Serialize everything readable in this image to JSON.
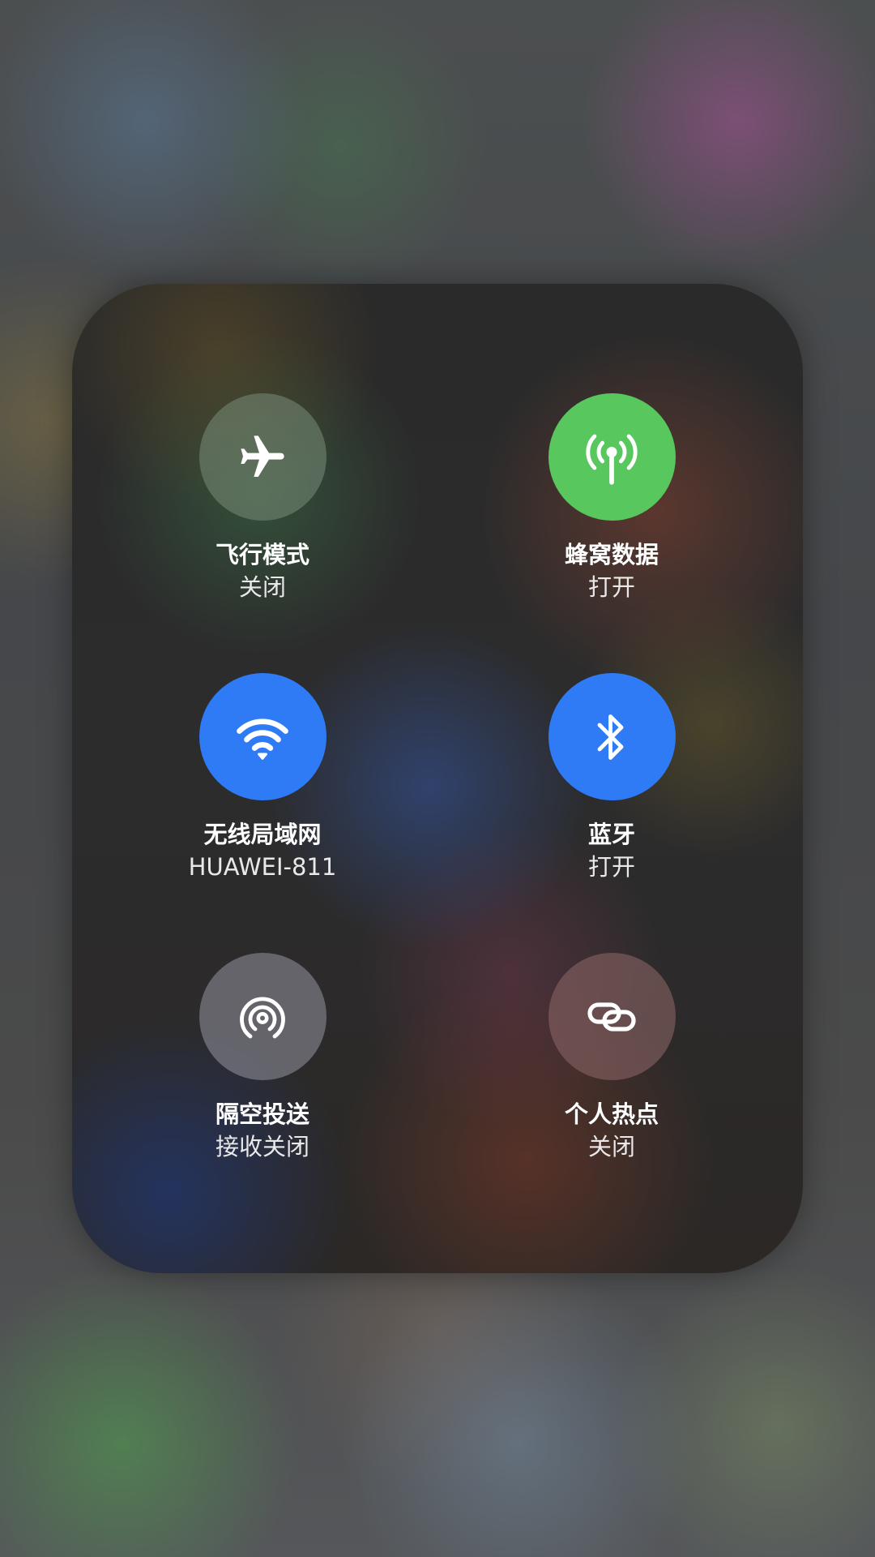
{
  "panel": {
    "tiles": [
      {
        "id": "airplane",
        "title": "飞行模式",
        "status": "关闭",
        "icon": "airplane-icon",
        "state": "off",
        "color": "#5a6a5c"
      },
      {
        "id": "cellular",
        "title": "蜂窝数据",
        "status": "打开",
        "icon": "antenna-icon",
        "state": "on",
        "color": "#58c75e"
      },
      {
        "id": "wifi",
        "title": "无线局域网",
        "status": "HUAWEI-811",
        "icon": "wifi-icon",
        "state": "on",
        "color": "#2f7bf6"
      },
      {
        "id": "bluetooth",
        "title": "蓝牙",
        "status": "打开",
        "icon": "bluetooth-icon",
        "state": "on",
        "color": "#2f7bf6"
      },
      {
        "id": "airdrop",
        "title": "隔空投送",
        "status": "接收关闭",
        "icon": "airdrop-icon",
        "state": "off",
        "color": "#6f6f76"
      },
      {
        "id": "hotspot",
        "title": "个人热点",
        "status": "关闭",
        "icon": "link-icon",
        "state": "off",
        "color": "#6b5452"
      }
    ]
  }
}
